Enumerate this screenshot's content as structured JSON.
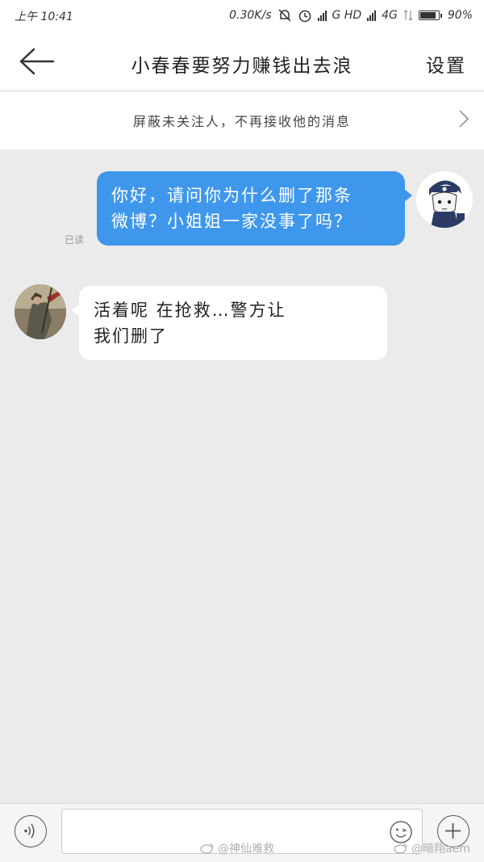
{
  "status_bar": {
    "time": "上午 10:41",
    "speed": "0.30K/s",
    "network": "G HD",
    "network2": "4G",
    "battery": "90%",
    "battery_level": 0.9
  },
  "header": {
    "title": "小春春要努力赚钱出去浪",
    "settings_label": "设置"
  },
  "notice": {
    "text": "屏蔽未关注人，不再接收他的消息"
  },
  "messages": [
    {
      "side": "right",
      "text_line1": "你好，请问你为什么删了那条",
      "text_line2": "微博？小姐姐一家没事了吗？",
      "status": "已读"
    },
    {
      "side": "left",
      "text_line1": "活着呢 在抢救…警方让",
      "text_line2": "我们删了"
    }
  ],
  "input": {
    "value": "",
    "placeholder": ""
  },
  "watermarks": [
    "@神仙难救",
    "@暗翔aem"
  ],
  "colors": {
    "bubble_out": "#3f97ec",
    "bubble_in": "#ffffff",
    "chat_bg": "#ebebeb"
  }
}
